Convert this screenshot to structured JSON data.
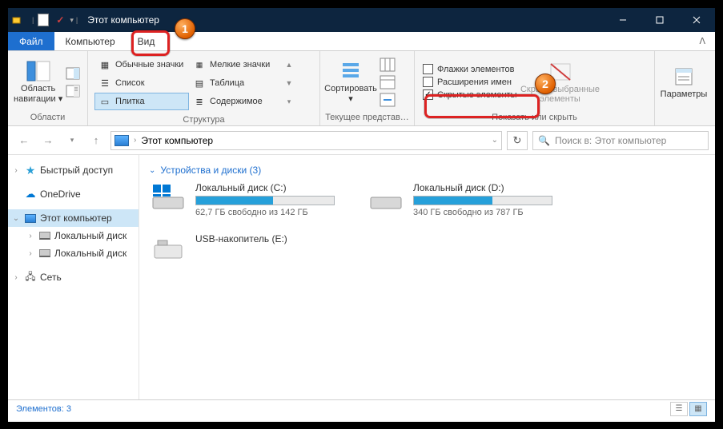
{
  "title": "Этот компьютер",
  "menu": {
    "file": "Файл",
    "computer": "Компьютер",
    "view": "Вид"
  },
  "ribbon": {
    "nav_pane": "Область навигации ▾",
    "g1_label": "Области",
    "layout": {
      "normal_icons": "Обычные значки",
      "small_icons": "Мелкие значки",
      "list": "Список",
      "table": "Таблица",
      "tiles": "Плитка",
      "content": "Содержимое"
    },
    "g2_label": "Структура",
    "sort": "Сортировать ▾",
    "g3_label": "Текущее представ…",
    "checks": {
      "flags": "Флажки элементов",
      "ext": "Расширения имен",
      "hidden": "Скрытые элементы"
    },
    "hide_sel": "Скрыть выбранные элементы",
    "g4_label": "Показать или скрыть",
    "options": "Параметры"
  },
  "address": {
    "path": "Этот компьютер",
    "search_placeholder": "Поиск в: Этот компьютер"
  },
  "sidebar": {
    "quick": "Быстрый доступ",
    "onedrive": "OneDrive",
    "thispc": "Этот компьютер",
    "local1": "Локальный диск",
    "local2": "Локальный диск",
    "network": "Сеть"
  },
  "section": {
    "header": "Устройства и диски (3)"
  },
  "drives": [
    {
      "name": "Локальный диск (C:)",
      "free": "62,7 ГБ свободно из 142 ГБ",
      "fill": 56
    },
    {
      "name": "Локальный диск (D:)",
      "free": "340 ГБ свободно из 787 ГБ",
      "fill": 57
    },
    {
      "name": "USB-накопитель (E:)",
      "free": "",
      "fill": 0
    }
  ],
  "status": {
    "count": "Элементов: 3"
  },
  "badges": {
    "one": "1",
    "two": "2"
  }
}
